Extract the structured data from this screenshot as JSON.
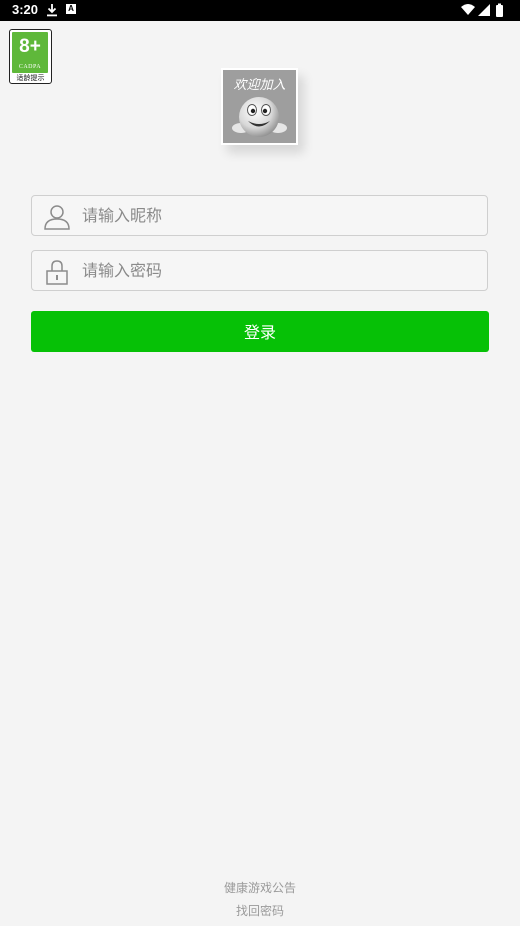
{
  "status_bar": {
    "time": "3:20",
    "download_icon": "download-icon",
    "notification_badge": "A",
    "wifi_icon": "wifi-icon",
    "signal_icon": "signal-icon",
    "battery_icon": "battery-icon"
  },
  "age_rating": {
    "value": "8+",
    "org": "CADPA",
    "label": "适龄提示",
    "color": "#5fb83a"
  },
  "avatar": {
    "caption": "欢迎加入",
    "icon": "smiley-face-icon"
  },
  "login_form": {
    "nickname": {
      "placeholder": "请输入昵称",
      "value": "",
      "icon": "user-icon"
    },
    "password": {
      "placeholder": "请输入密码",
      "value": "",
      "icon": "lock-icon"
    },
    "submit_label": "登录",
    "submit_color": "#06c106"
  },
  "footer": {
    "notice_link": "健康游戏公告",
    "recover_link": "找回密码"
  }
}
